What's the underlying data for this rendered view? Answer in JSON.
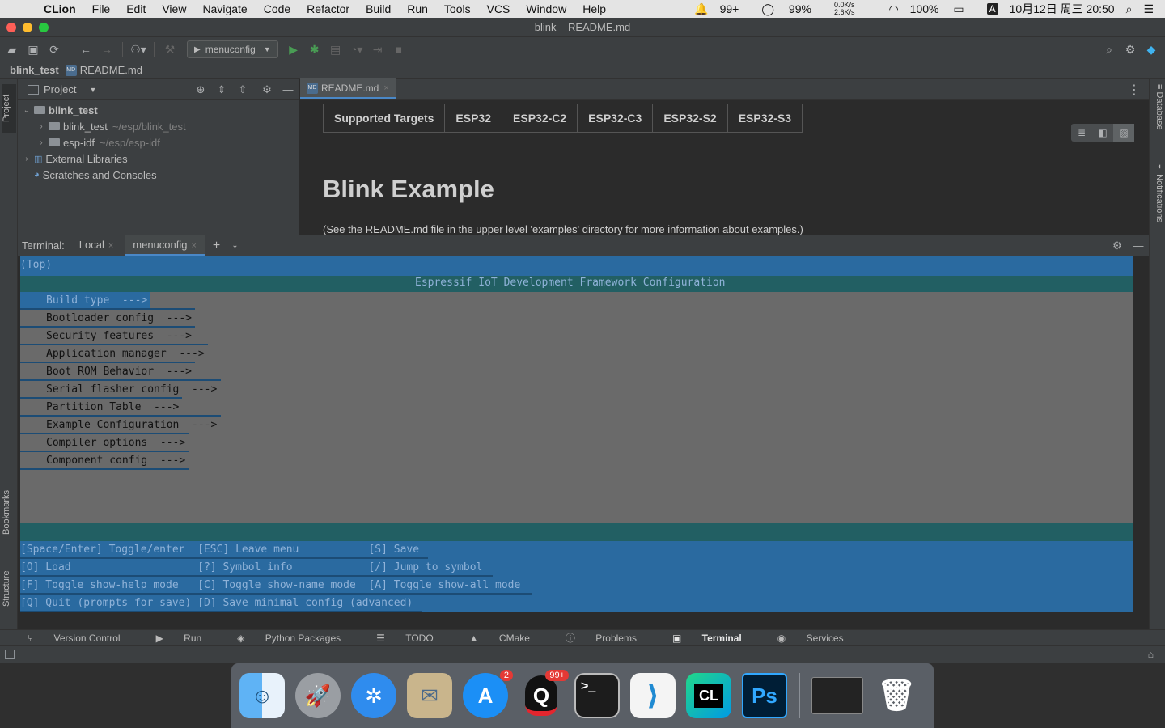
{
  "menubar": {
    "app": "CLion",
    "items": [
      "File",
      "Edit",
      "View",
      "Navigate",
      "Code",
      "Refactor",
      "Build",
      "Run",
      "Tools",
      "VCS",
      "Window",
      "Help"
    ],
    "status": {
      "notifications": "99+",
      "cpu": "99%",
      "net_up": "0.0K/s",
      "net_down": "2.6K/s",
      "battery": "100%",
      "input": "A",
      "datetime": "10月12日 周三 20:50"
    }
  },
  "window": {
    "title": "blink – README.md"
  },
  "toolbar": {
    "run_config": "menuconfig"
  },
  "breadcrumb": {
    "project": "blink_test",
    "file": "README.md"
  },
  "left_stripe": {
    "project": "Project",
    "bookmarks": "Bookmarks",
    "structure": "Structure"
  },
  "right_stripe": {
    "database": "Database",
    "notifications": "Notifications"
  },
  "project_panel": {
    "title": "Project",
    "tree": [
      {
        "label": "blink_test",
        "path": ""
      },
      {
        "label": "blink_test",
        "path": "~/esp/blink_test"
      },
      {
        "label": "esp-idf",
        "path": "~/esp/esp-idf"
      },
      {
        "label": "External Libraries",
        "path": ""
      },
      {
        "label": "Scratches and Consoles",
        "path": ""
      }
    ]
  },
  "editor": {
    "tab": "README.md",
    "targets": [
      "Supported Targets",
      "ESP32",
      "ESP32-C2",
      "ESP32-C3",
      "ESP32-S2",
      "ESP32-S3"
    ],
    "heading": "Blink Example",
    "paragraph": "(See the README.md file in the upper level 'examples' directory for more information about examples.)"
  },
  "terminal": {
    "label": "Terminal:",
    "tabs": [
      "Local",
      "menuconfig"
    ],
    "menuconfig": {
      "path": "(Top)",
      "title": "Espressif IoT Development Framework Configuration",
      "items": [
        "Build type  --->",
        "Bootloader config  --->",
        "Security features  --->",
        "Application manager  --->",
        "Boot ROM Behavior  --->",
        "Serial flasher config  --->",
        "Partition Table  --->",
        "Example Configuration  --->",
        "Compiler options  --->",
        "Component config  --->"
      ],
      "help": [
        "[Space/Enter] Toggle/enter  [ESC] Leave menu           [S] Save",
        "[O] Load                    [?] Symbol info            [/] Jump to symbol",
        "[F] Toggle show-help mode   [C] Toggle show-name mode  [A] Toggle show-all mode",
        "[Q] Quit (prompts for save) [D] Save minimal config (advanced)"
      ]
    }
  },
  "tool_windows": [
    "Version Control",
    "Run",
    "Python Packages",
    "TODO",
    "CMake",
    "Problems",
    "Terminal",
    "Services"
  ],
  "dock": {
    "apps": [
      {
        "name": "finder",
        "glyph": "☺"
      },
      {
        "name": "launchpad",
        "glyph": "🚀"
      },
      {
        "name": "safari",
        "glyph": "✲"
      },
      {
        "name": "mail",
        "glyph": "✉"
      },
      {
        "name": "app-store",
        "glyph": "A",
        "badge": "2"
      },
      {
        "name": "qq",
        "glyph": "Q",
        "badge": "99+"
      },
      {
        "name": "terminal",
        "glyph": ">_"
      },
      {
        "name": "vscode",
        "glyph": "⟩"
      },
      {
        "name": "clion",
        "glyph": "CL"
      },
      {
        "name": "photoshop",
        "glyph": "Ps"
      }
    ],
    "trash_glyph": "🗑"
  }
}
